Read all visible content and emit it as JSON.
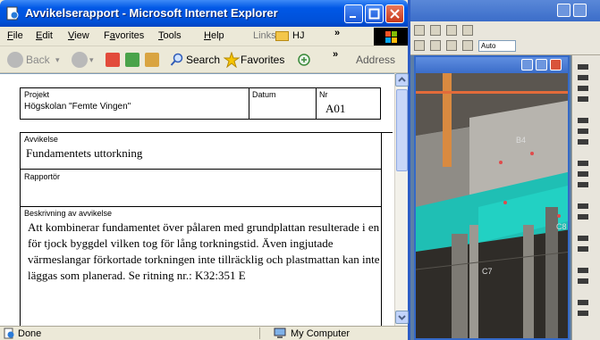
{
  "window": {
    "title": "Avvikelserapport - Microsoft Internet Explorer",
    "colors": {
      "titlebar": "#0058e6",
      "close": "#c7391c",
      "page": "#ffffff",
      "chrome": "#ece9d8"
    }
  },
  "menu": {
    "items": [
      {
        "mnemonic": "F",
        "rest": "ile"
      },
      {
        "mnemonic": "E",
        "rest": "dit"
      },
      {
        "mnemonic": "V",
        "rest": "iew"
      },
      {
        "lead": "F",
        "mnemonic": "a",
        "rest": "vorites"
      },
      {
        "mnemonic": "T",
        "rest": "ools"
      },
      {
        "mnemonic": "H",
        "rest": "elp"
      }
    ],
    "links_label": "Links",
    "links_folder": "HJ",
    "chevron": "»"
  },
  "toolbar": {
    "back_label": "Back",
    "search_label": "Search",
    "favorites_label": "Favorites",
    "chevron": "»",
    "address_label": "Address",
    "icons": [
      "back-arrow-icon",
      "forward-arrow-icon",
      "stop-icon",
      "refresh-icon",
      "home-icon",
      "search-icon",
      "favorites-star-icon",
      "media-icon"
    ]
  },
  "document": {
    "projekt_label": "Projekt",
    "projekt_value": "Högskolan \"Femte Vingen\"",
    "datum_label": "Datum",
    "datum_value": "",
    "nr_label": "Nr",
    "nr_value": "A01",
    "avvikelse_label": "Avvikelse",
    "avvikelse_value": "Fundamentets uttorkning",
    "rapportor_label": "Rapportör",
    "rapportor_value": "",
    "beskrivning_label": "Beskrivning av avvikelse",
    "beskrivning_value": "Att kombinerar fundamentet över pålaren med grundplattan resulterade i en för tjock byggdel vilken tog för lång torkningstid. Även ingjutade värmeslangar förkortade torkningen inte tillräcklig och plastmattan kan inte läggas som planerad. Se ritning nr.: K32:351 E"
  },
  "status": {
    "left": "Done",
    "zone": "My Computer"
  },
  "background_app": {
    "combo_value": "Auto",
    "scene_labels": [
      "B4",
      "C7",
      "C8"
    ]
  }
}
